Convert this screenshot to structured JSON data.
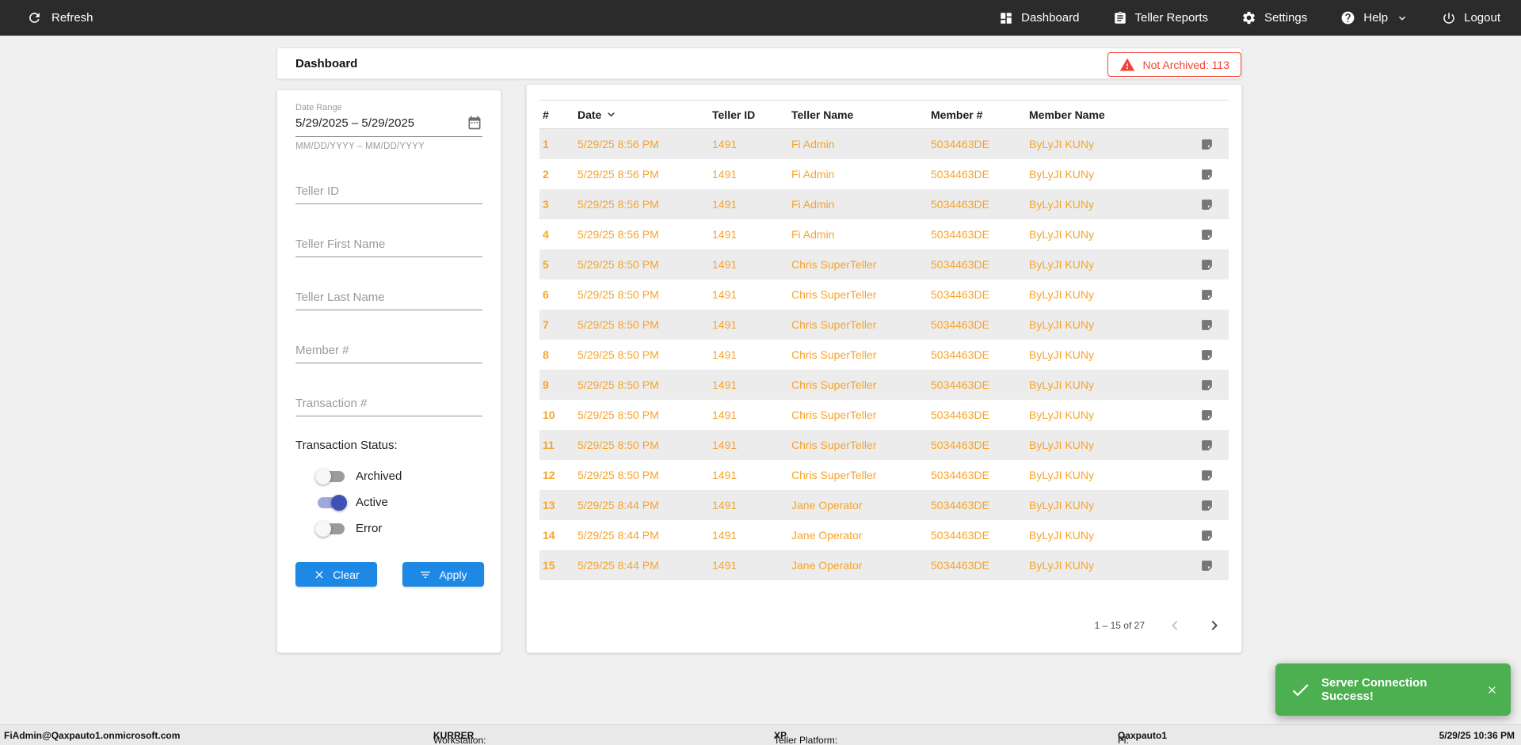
{
  "navbar": {
    "refresh_label": "Refresh",
    "items": [
      {
        "key": "dashboard",
        "label": "Dashboard"
      },
      {
        "key": "teller-reports",
        "label": "Teller Reports"
      },
      {
        "key": "settings",
        "label": "Settings"
      },
      {
        "key": "help",
        "label": "Help"
      },
      {
        "key": "logout",
        "label": "Logout"
      }
    ]
  },
  "header": {
    "title": "Dashboard",
    "not_archived_label": "Not Archived: 113"
  },
  "filters": {
    "date_range": {
      "label": "Date Range",
      "value": "5/29/2025 – 5/29/2025",
      "hint": "MM/DD/YYYY – MM/DD/YYYY"
    },
    "fields": [
      {
        "key": "teller-id",
        "placeholder": "Teller ID"
      },
      {
        "key": "teller-first-name",
        "placeholder": "Teller First Name"
      },
      {
        "key": "teller-last-name",
        "placeholder": "Teller Last Name"
      },
      {
        "key": "member-number",
        "placeholder": "Member #"
      },
      {
        "key": "transaction-number",
        "placeholder": "Transaction #"
      }
    ],
    "status": {
      "label": "Transaction Status:",
      "toggles": [
        {
          "key": "archived",
          "label": "Archived",
          "on": false
        },
        {
          "key": "active",
          "label": "Active",
          "on": true
        },
        {
          "key": "error",
          "label": "Error",
          "on": false
        }
      ]
    },
    "clear_label": "Clear",
    "apply_label": "Apply"
  },
  "table": {
    "columns": [
      "#",
      "Date",
      "Teller ID",
      "Teller Name",
      "Member #",
      "Member Name"
    ],
    "sorted_column": "Date",
    "rows": [
      {
        "num": "1",
        "date": "5/29/25 8:56 PM",
        "teller_id": "1491",
        "teller_name": "Fi Admin",
        "member_num": "5034463DE",
        "member_name": "ByLyJI KUNy"
      },
      {
        "num": "2",
        "date": "5/29/25 8:56 PM",
        "teller_id": "1491",
        "teller_name": "Fi Admin",
        "member_num": "5034463DE",
        "member_name": "ByLyJI KUNy"
      },
      {
        "num": "3",
        "date": "5/29/25 8:56 PM",
        "teller_id": "1491",
        "teller_name": "Fi Admin",
        "member_num": "5034463DE",
        "member_name": "ByLyJI KUNy"
      },
      {
        "num": "4",
        "date": "5/29/25 8:56 PM",
        "teller_id": "1491",
        "teller_name": "Fi Admin",
        "member_num": "5034463DE",
        "member_name": "ByLyJI KUNy"
      },
      {
        "num": "5",
        "date": "5/29/25 8:50 PM",
        "teller_id": "1491",
        "teller_name": "Chris SuperTeller",
        "member_num": "5034463DE",
        "member_name": "ByLyJI KUNy"
      },
      {
        "num": "6",
        "date": "5/29/25 8:50 PM",
        "teller_id": "1491",
        "teller_name": "Chris SuperTeller",
        "member_num": "5034463DE",
        "member_name": "ByLyJI KUNy"
      },
      {
        "num": "7",
        "date": "5/29/25 8:50 PM",
        "teller_id": "1491",
        "teller_name": "Chris SuperTeller",
        "member_num": "5034463DE",
        "member_name": "ByLyJI KUNy"
      },
      {
        "num": "8",
        "date": "5/29/25 8:50 PM",
        "teller_id": "1491",
        "teller_name": "Chris SuperTeller",
        "member_num": "5034463DE",
        "member_name": "ByLyJI KUNy"
      },
      {
        "num": "9",
        "date": "5/29/25 8:50 PM",
        "teller_id": "1491",
        "teller_name": "Chris SuperTeller",
        "member_num": "5034463DE",
        "member_name": "ByLyJI KUNy"
      },
      {
        "num": "10",
        "date": "5/29/25 8:50 PM",
        "teller_id": "1491",
        "teller_name": "Chris SuperTeller",
        "member_num": "5034463DE",
        "member_name": "ByLyJI KUNy"
      },
      {
        "num": "11",
        "date": "5/29/25 8:50 PM",
        "teller_id": "1491",
        "teller_name": "Chris SuperTeller",
        "member_num": "5034463DE",
        "member_name": "ByLyJI KUNy"
      },
      {
        "num": "12",
        "date": "5/29/25 8:50 PM",
        "teller_id": "1491",
        "teller_name": "Chris SuperTeller",
        "member_num": "5034463DE",
        "member_name": "ByLyJI KUNy"
      },
      {
        "num": "13",
        "date": "5/29/25 8:44 PM",
        "teller_id": "1491",
        "teller_name": "Jane Operator",
        "member_num": "5034463DE",
        "member_name": "ByLyJI KUNy"
      },
      {
        "num": "14",
        "date": "5/29/25 8:44 PM",
        "teller_id": "1491",
        "teller_name": "Jane Operator",
        "member_num": "5034463DE",
        "member_name": "ByLyJI KUNy"
      },
      {
        "num": "15",
        "date": "5/29/25 8:44 PM",
        "teller_id": "1491",
        "teller_name": "Jane Operator",
        "member_num": "5034463DE",
        "member_name": "ByLyJI KUNy"
      }
    ],
    "pagination": {
      "range_label": "1 – 15 of 27"
    }
  },
  "toast": {
    "message": "Server Connection Success!"
  },
  "status_bar": {
    "user": "FiAdmin@Qaxpauto1.onmicrosoft.com",
    "workstation_label": "Workstation: ",
    "workstation": "KURRER",
    "platform_label": "Teller Platform: ",
    "platform": "XP",
    "fi_label": "FI: ",
    "fi": "Qaxpauto1",
    "datetime": "5/29/25 10:36 PM"
  },
  "colors": {
    "navbar_bg": "#2b2b2b",
    "accent_orange": "#f7a42b",
    "button_blue": "#1e88e5",
    "toggle_on_indigo": "#3f51b5",
    "toast_green": "#4caf50",
    "alert_red": "#f44336",
    "row_alt_gray": "#ececec"
  }
}
